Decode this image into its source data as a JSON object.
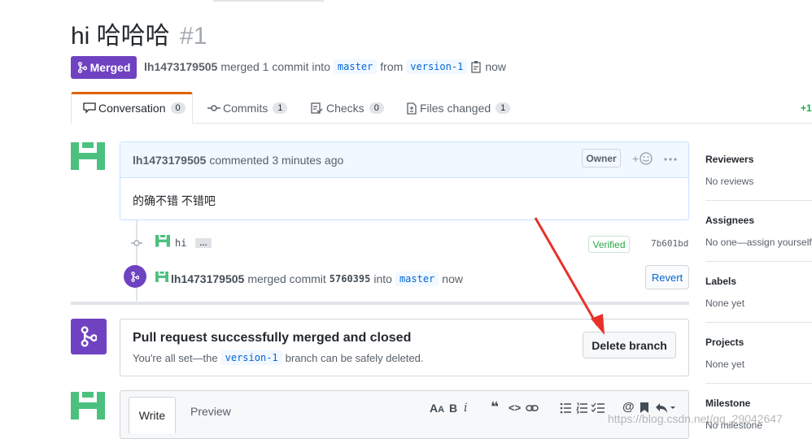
{
  "pr": {
    "title": "hi 哈哈哈",
    "number": "#1",
    "state_label": "Merged",
    "author": "lh1473179505",
    "meta_text": "merged 1 commit into",
    "base_branch": "master",
    "from_text": "from",
    "head_branch": "version-1",
    "time": "now"
  },
  "tabs": [
    {
      "label": "Conversation",
      "count": "0"
    },
    {
      "label": "Commits",
      "count": "1"
    },
    {
      "label": "Checks",
      "count": "0"
    },
    {
      "label": "Files changed",
      "count": "1"
    }
  ],
  "diffstat": "+1",
  "comment": {
    "author": "lh1473179505",
    "action": "commented 3 minutes ago",
    "role_badge": "Owner",
    "reaction_plus": "+",
    "body": "的确不错 不错吧"
  },
  "commit_row": {
    "message": "hi",
    "ellipsis": "…",
    "verified": "Verified",
    "sha": "7b601bd"
  },
  "merge_event": {
    "author": "lh1473179505",
    "text": "merged commit",
    "sha": "5760395",
    "into": "into",
    "branch": "master",
    "time": "now",
    "revert_label": "Revert"
  },
  "merged_box": {
    "heading": "Pull request successfully merged and closed",
    "text_before": "You're all set—the",
    "branch": "version-1",
    "text_after": "branch can be safely deleted.",
    "delete_label": "Delete branch"
  },
  "editor": {
    "write_tab": "Write",
    "preview_tab": "Preview"
  },
  "sidebar": {
    "reviewers_title": "Reviewers",
    "reviewers_value": "No reviews",
    "assignees_title": "Assignees",
    "assignees_value": "No one—assign yourself",
    "labels_title": "Labels",
    "labels_value": "None yet",
    "projects_title": "Projects",
    "projects_value": "None yet",
    "milestone_title": "Milestone",
    "milestone_value": "No milestone"
  },
  "watermark": "https://blog.csdn.net/qq_29042647",
  "colors": {
    "merged_purple": "#6f42c1",
    "annotation_red": "#e8312b",
    "avatar_green": "#4cc17f",
    "link_blue": "#0366d6"
  }
}
